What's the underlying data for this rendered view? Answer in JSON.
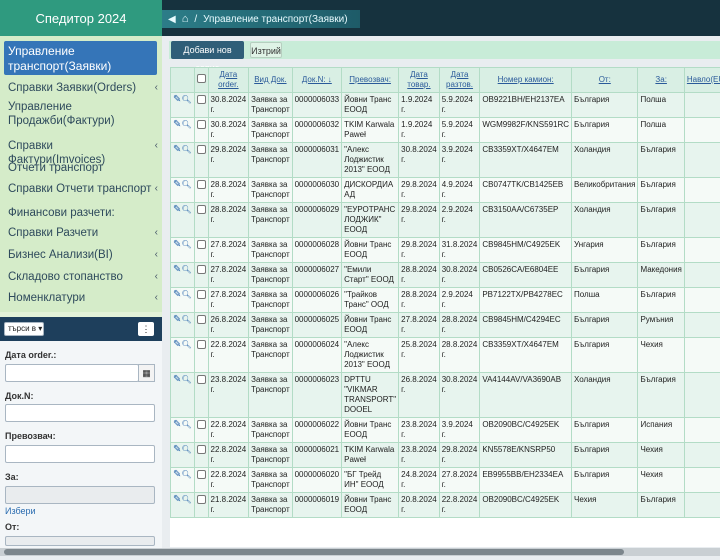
{
  "app": {
    "brand": "Спедитор 2024"
  },
  "breadcrumb": {
    "current": "Управление транспорт(Заявки)"
  },
  "sidebar": {
    "active": "Управление транспорт(Заявки)",
    "items": [
      {
        "label": "Справки Заявки(Orders)",
        "chevron": "‹"
      },
      {
        "label": "Управление Продажби(Фактури)",
        "chevron": ""
      },
      {
        "label": "Справки Фактури(Imvoices)",
        "chevron": "‹"
      },
      {
        "label": "Отчети транспорт",
        "chevron": ""
      },
      {
        "label": "Справки Отчети транспорт",
        "chevron": "‹"
      },
      {
        "label": "Финансови разчети:",
        "chevron": ""
      },
      {
        "label": "Справки Разчети",
        "chevron": "‹"
      },
      {
        "label": "Бизнес Анализи(BI)",
        "chevron": "‹"
      },
      {
        "label": "Складово стопанство",
        "chevron": "‹"
      },
      {
        "label": "Номенклатури",
        "chevron": "‹"
      }
    ]
  },
  "search": {
    "mode": "търси в",
    "date_label": "Дата order.:",
    "doc_label": "Док.N:",
    "carrier_label": "Превозвач:",
    "for_label": "За:",
    "choose_link": "Избери",
    "from_label": "От:"
  },
  "toolbar": {
    "add_label": "Добави нов запис",
    "clear_label": "Изтрий"
  },
  "table": {
    "headers": [
      "Дата order.",
      "Вид Док.",
      "Док.N: ↓",
      "Превозвач:",
      "Дата товар.",
      "Дата разтов.",
      "Номер камион:",
      "От:",
      "За:",
      "Навло(EUR)"
    ],
    "rows": [
      [
        "30.8.2024 г.",
        "Заявка за Транспорт",
        "0000006033",
        "Йовни Транс ЕООД",
        "1.9.2024 г.",
        "5.9.2024 г.",
        "OB9221BH/EH2137EA",
        "България",
        "Полша",
        ""
      ],
      [
        "30.8.2024 г.",
        "Заявка за Транспорт",
        "0000006032",
        "TKIM Karwala Paweł",
        "1.9.2024 г.",
        "5.9.2024 г.",
        "WGM9982F/KNS591RC",
        "България",
        "Полша",
        ""
      ],
      [
        "29.8.2024 г.",
        "Заявка за Транспорт",
        "0000006031",
        "\"Алекс Лоджистик 2013\" ЕООД",
        "30.8.2024 г.",
        "3.9.2024 г.",
        "CB3359XT/X4647EM",
        "Холандия",
        "България",
        ""
      ],
      [
        "28.8.2024 г.",
        "Заявка за Транспорт",
        "0000006030",
        "ДИСКОРДИА АД",
        "29.8.2024 г.",
        "4.9.2024 г.",
        "CB0747TK/CB1425EB",
        "Великобритания",
        "България",
        ""
      ],
      [
        "28.8.2024 г.",
        "Заявка за Транспорт",
        "0000006029",
        "\"ЕУРОТРАНС ЛОДЖИК\" ЕООД",
        "29.8.2024 г.",
        "2.9.2024 г.",
        "CB3150AA/C6735EP",
        "Холандия",
        "България",
        ""
      ],
      [
        "27.8.2024 г.",
        "Заявка за Транспорт",
        "0000006028",
        "Йовни Транс ЕООД",
        "29.8.2024 г.",
        "31.8.2024 г.",
        "CB9845HM/C4925EK",
        "Унгария",
        "България",
        ""
      ],
      [
        "27.8.2024 г.",
        "Заявка за Транспорт",
        "0000006027",
        "\"Емили Старт\" ЕООД",
        "28.8.2024 г.",
        "30.8.2024 г.",
        "CB0526CA/E6804EE",
        "България",
        "Македония",
        ""
      ],
      [
        "27.8.2024 г.",
        "Заявка за Транспорт",
        "0000006026",
        "\"Трайков Транс\" ООД",
        "28.8.2024 г.",
        "2.9.2024 г.",
        "PB7122TX/PB4278EC",
        "Полша",
        "България",
        ""
      ],
      [
        "26.8.2024 г.",
        "Заявка за Транспорт",
        "0000006025",
        "Йовни Транс ЕООД",
        "27.8.2024 г.",
        "28.8.2024 г.",
        "CB9845HM/C4294EC",
        "България",
        "Румъния",
        ""
      ],
      [
        "22.8.2024 г.",
        "Заявка за Транспорт",
        "0000006024",
        "\"Алекс Лоджистик 2013\" ЕООД",
        "25.8.2024 г.",
        "28.8.2024 г.",
        "CB3359XT/X4647EM",
        "България",
        "Чехия",
        ""
      ],
      [
        "23.8.2024 г.",
        "Заявка за Транспорт",
        "0000006023",
        "DPTTU \"VIKMAR TRANSPORT\" DOOEL",
        "26.8.2024 г.",
        "30.8.2024 г.",
        "VA4144AV/VA3690AB",
        "Холандия",
        "България",
        ""
      ],
      [
        "22.8.2024 г.",
        "Заявка за Транспорт",
        "0000006022",
        "Йовни Транс ЕООД",
        "23.8.2024 г.",
        "3.9.2024 г.",
        "OB2090BC/C4925EK",
        "България",
        "Испания",
        ""
      ],
      [
        "22.8.2024 г.",
        "Заявка за Транспорт",
        "0000006021",
        "TKIM Karwala Paweł",
        "23.8.2024 г.",
        "29.8.2024 г.",
        "KN5578E/KNSRP50",
        "България",
        "Чехия",
        ""
      ],
      [
        "22.8.2024 г.",
        "Заявка за Транспорт",
        "0000006020",
        "\"БГ Трейд ИН\" ЕООД",
        "24.8.2024 г.",
        "27.8.2024 г.",
        "EB9955BB/EH2334EA",
        "България",
        "Чехия",
        ""
      ],
      [
        "21.8.2024 г.",
        "Заявка за Транспорт",
        "0000006019",
        "Йовни Транс ЕООД",
        "20.8.2024 г.",
        "22.8.2024 г.",
        "OB2090BC/C4925EK",
        "Чехия",
        "България",
        ""
      ]
    ]
  }
}
